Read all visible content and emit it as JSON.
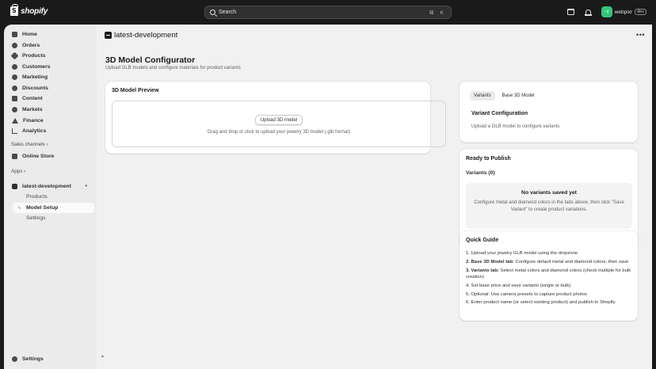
{
  "topbar": {
    "logo_text": "shopify",
    "search_placeholder": "Search",
    "search_shortcut": "⌘ K",
    "avatar_initials": "· c",
    "account_name": "webpixr",
    "account_badge": "dev"
  },
  "sidebar": {
    "items": [
      {
        "label": "Home",
        "icon": "home-icon"
      },
      {
        "label": "Orders",
        "icon": "orders-icon"
      },
      {
        "label": "Products",
        "icon": "tag-icon"
      },
      {
        "label": "Customers",
        "icon": "person-icon"
      },
      {
        "label": "Marketing",
        "icon": "target-icon"
      },
      {
        "label": "Discounts",
        "icon": "discount-icon"
      },
      {
        "label": "Content",
        "icon": "content-icon"
      },
      {
        "label": "Markets",
        "icon": "globe-icon"
      },
      {
        "label": "Finance",
        "icon": "bank-icon"
      },
      {
        "label": "Analytics",
        "icon": "chart-icon"
      }
    ],
    "sales_channels_label": "Sales channels ›",
    "online_store_label": "Online Store",
    "apps_label": "Apps ›",
    "app_name": "latest-development",
    "app_sub_items": [
      "Products",
      "Model Setup",
      "Settings"
    ],
    "settings_label": "Settings"
  },
  "main": {
    "app_title": "latest-development",
    "page_title": "3D Model Configurator",
    "page_subtitle": "Upload GLB models and configure materials for product variants",
    "preview": {
      "title": "3D Model Preview",
      "upload_button": "Upload 3D model",
      "hint": "Drag and drop or click to upload your jewelry 3D model (.glb format)"
    },
    "variants": {
      "tabs": [
        "Variants",
        "Base 3D Model"
      ],
      "active_tab": "Variants",
      "title": "Variant Configuration",
      "subtitle": "Upload a GLB model to configure variants"
    },
    "publish": {
      "title": "Ready to Publish",
      "count_label": "Variants (0)",
      "empty_title": "No variants saved yet",
      "empty_desc": "Configure metal and diamond colors in the tabs above, then click \"Save Variant\" to create product variations."
    },
    "guide": {
      "title": "Quick Guide",
      "steps": [
        {
          "bold": "",
          "text": "1. Upload your jewelry GLB model using the dropzone"
        },
        {
          "bold": "2. Base 3D Model tab:",
          "text": " Configure default metal and diamond colors, then save"
        },
        {
          "bold": "3. Variants tab:",
          "text": " Select metal colors and diamond colors (check multiple for bulk creation)"
        },
        {
          "bold": "",
          "text": "4. Set base price and save variants (single or bulk)"
        },
        {
          "bold": "",
          "text": "5. Optional: Use camera presets to capture product photos"
        },
        {
          "bold": "",
          "text": "6. Enter product name (or select existing product) and publish to Shopify"
        }
      ]
    },
    "scroll_up": "⌃"
  }
}
